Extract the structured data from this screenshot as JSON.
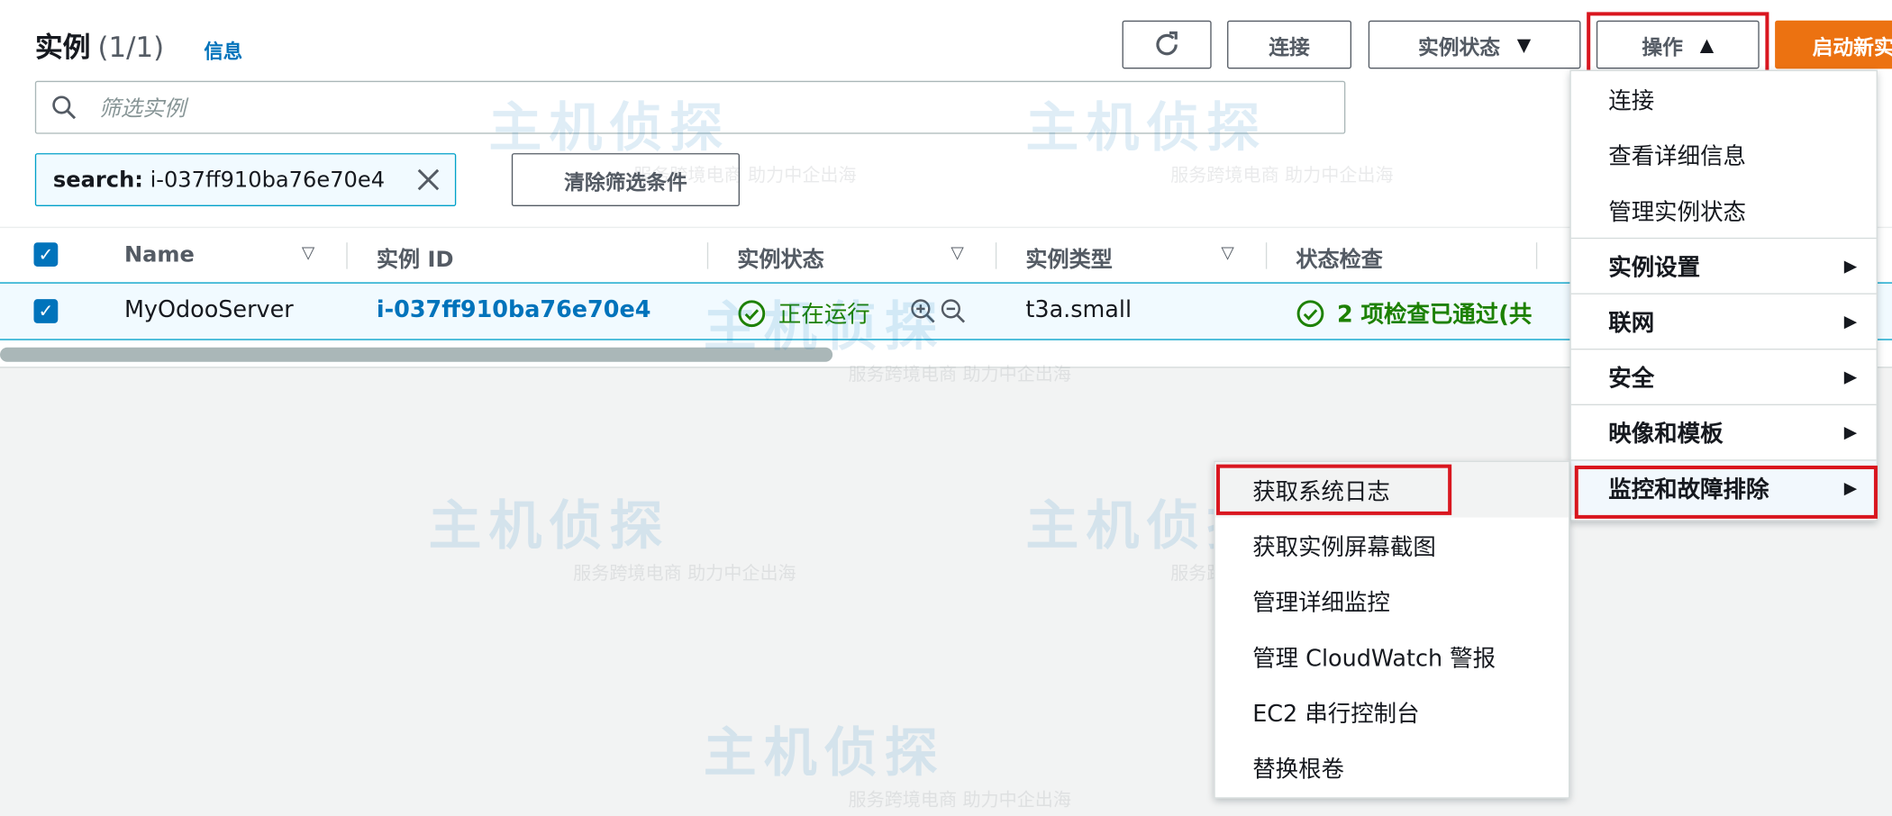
{
  "header": {
    "title": "实例",
    "count": "(1/1)",
    "info_link": "信息"
  },
  "toolbar": {
    "connect_label": "连接",
    "instance_state_label": "实例状态",
    "actions_label": "操作",
    "launch_label": "启动新实例"
  },
  "search": {
    "placeholder": "筛选实例"
  },
  "filter": {
    "token_key": "search:",
    "token_value": "i-037ff910ba76e70e4",
    "clear_label": "清除筛选条件"
  },
  "table": {
    "columns": [
      "Name",
      "实例 ID",
      "实例状态",
      "实例类型",
      "状态检查"
    ],
    "rows": [
      {
        "name": "MyOdooServer",
        "instance_id": "i-037ff910ba76e70e4",
        "state": "正在运行",
        "type": "t3a.small",
        "status_check": "2 项检查已通过(共"
      }
    ]
  },
  "actions_menu": {
    "items": [
      {
        "label": "连接",
        "submenu": false
      },
      {
        "label": "查看详细信息",
        "submenu": false
      },
      {
        "label": "管理实例状态",
        "submenu": false
      },
      {
        "label": "实例设置",
        "submenu": true
      },
      {
        "label": "联网",
        "submenu": true
      },
      {
        "label": "安全",
        "submenu": true
      },
      {
        "label": "映像和模板",
        "submenu": true
      },
      {
        "label": "监控和故障排除",
        "submenu": true
      }
    ]
  },
  "monitor_submenu": {
    "items": [
      "获取系统日志",
      "获取实例屏幕截图",
      "管理详细监控",
      "管理 CloudWatch 警报",
      "EC2 串行控制台",
      "替换根卷"
    ]
  },
  "watermark": {
    "logo": "主机侦探",
    "tagline": "服务跨境电商 助力中企出海"
  },
  "colors": {
    "accent": "#0073bb",
    "primary_button": "#ec7211",
    "highlight": "#d9161f",
    "success": "#1d8102"
  },
  "icons": [
    "search-icon",
    "refresh-icon",
    "close-icon",
    "caret-down-icon",
    "caret-up-icon",
    "status-ok-icon",
    "zoom-in-icon",
    "zoom-out-icon",
    "chevron-right-icon"
  ]
}
